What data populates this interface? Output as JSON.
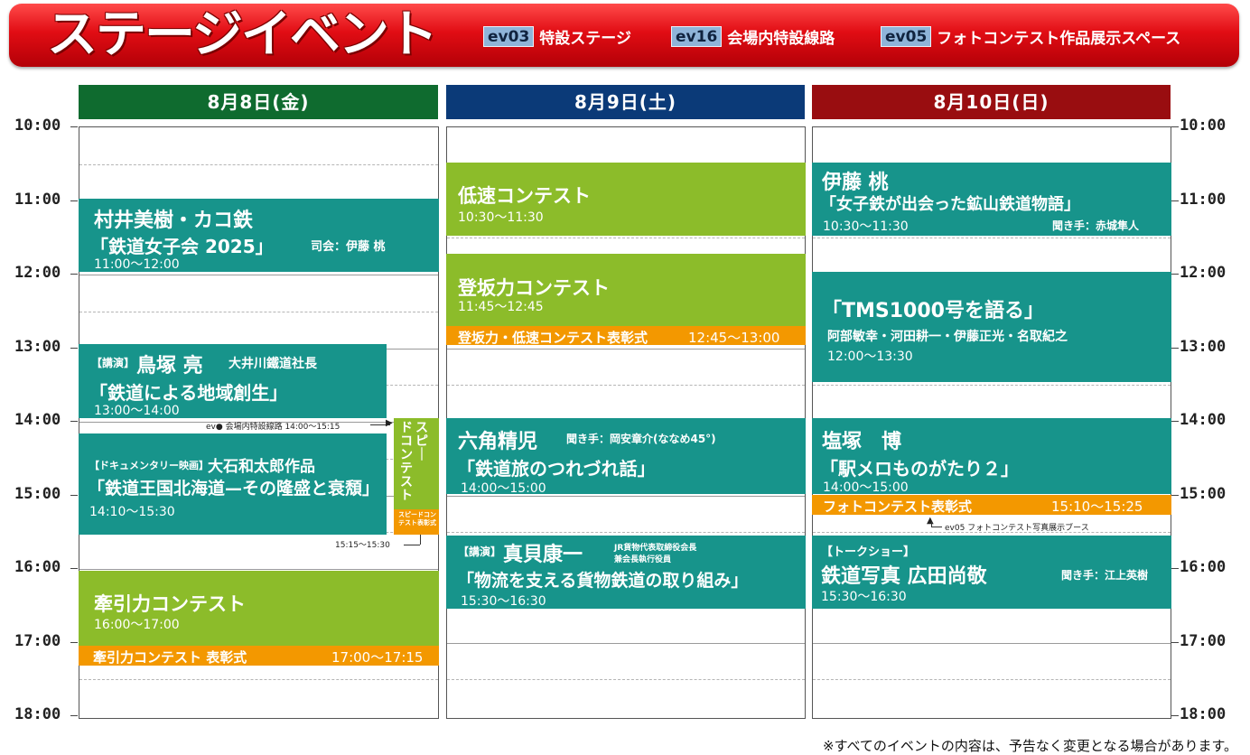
{
  "header": {
    "title": "ステージイベント",
    "legend": [
      {
        "code": "ev03",
        "label": "特設ステージ"
      },
      {
        "code": "ev16",
        "label": "会場内特設線路"
      },
      {
        "code": "ev05",
        "label": "フォトコンテスト作品展示スペース"
      }
    ]
  },
  "days": [
    {
      "label": "8月8日(金)",
      "color": "#0f6b2f"
    },
    {
      "label": "8月9日(土)",
      "color": "#0b3a78"
    },
    {
      "label": "8月10日(日)",
      "color": "#990d10"
    }
  ],
  "times": [
    "10:00",
    "11:00",
    "12:00",
    "13:00",
    "14:00",
    "15:00",
    "16:00",
    "17:00",
    "18:00"
  ],
  "colors": {
    "teal": "#17948b",
    "green": "#8cbc2a",
    "orange": "#f39800"
  },
  "day1": {
    "ev1": {
      "title": "村井美樹・カコ鉄",
      "sub": "「鉄道女子会 2025」",
      "host": "司会：伊藤 桃",
      "time": "11:00～12:00"
    },
    "ev2": {
      "tag": "【講演】",
      "name": "鳥塚 亮",
      "role": "大井川鐵道社長",
      "sub": "「鉄道による地域創生」",
      "time": "13:00～14:00"
    },
    "ev3": {
      "tag": "【ドキュメンタリー映画】",
      "name": "大石和太郎作品",
      "sub": "「鉄道王国北海道—その隆盛と衰頽」",
      "time": "14:10～15:30"
    },
    "ann_ev16": "ev● 会場内特設線路 14:00～15:15",
    "speed": {
      "title": "スピードコンテスト",
      "award": "スピードコンテスト表彰式",
      "time": "15:15～15:30"
    },
    "ev4": {
      "title": "牽引力コンテスト",
      "time": "16:00～17:00"
    },
    "ev5": {
      "title": "牽引力コンテスト 表彰式",
      "time": "17:00～17:15"
    }
  },
  "day2": {
    "ev1": {
      "title": "低速コンテスト",
      "time": "10:30～11:30"
    },
    "ev2": {
      "title": "登坂力コンテスト",
      "time": "11:45～12:45"
    },
    "ev3": {
      "title": "登坂力・低速コンテスト表彰式",
      "time": "12:45～13:00"
    },
    "ev4": {
      "name": "六角精児",
      "host": "聞き手：岡安章介(ななめ45°)",
      "sub": "「鉄道旅のつれづれ話」",
      "time": "14:00～15:00"
    },
    "ev5": {
      "tag": "【講演】",
      "name": "真貝康一",
      "role1": "JR貨物代表取締役会長",
      "role2": "兼会長執行役員",
      "sub": "「物流を支える貨物鉄道の取り組み」",
      "time": "15:30～16:30"
    }
  },
  "day3": {
    "ev1": {
      "name": "伊藤 桃",
      "sub": "「女子鉄が出会った鉱山鉄道物語」",
      "time": "10:30～11:30",
      "host": "聞き手：赤城隼人"
    },
    "ev2": {
      "sub": "「TMS1000号を語る」",
      "people": "阿部敏幸・河田耕一・伊藤正光・名取紀之",
      "time": "12:00～13:30"
    },
    "ev3": {
      "name": "塩塚　博",
      "sub": "「駅メロものがたり２」",
      "time": "14:00～15:00"
    },
    "ev4": {
      "title": "フォトコンテスト表彰式",
      "time": "15:10～15:25"
    },
    "ann_ev05": "ev05 フォトコンテスト写真展示ブース",
    "ev5": {
      "tag": "【トークショー】",
      "name": "鉄道写真 広田尚敬",
      "host": "聞き手：江上英樹",
      "time": "15:30～16:30"
    }
  },
  "footnote": "※すべてのイベントの内容は、予告なく変更となる場合があります。"
}
